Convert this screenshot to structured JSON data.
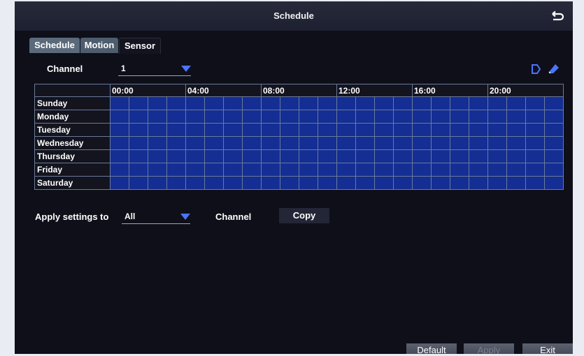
{
  "window": {
    "title": "Schedule"
  },
  "tabs": [
    {
      "label": "Schedule"
    },
    {
      "label": "Motion"
    },
    {
      "label": "Sensor"
    }
  ],
  "channel": {
    "label": "Channel",
    "value": "1"
  },
  "grid": {
    "hour_labels": [
      "00:00",
      "04:00",
      "08:00",
      "12:00",
      "16:00",
      "20:00"
    ],
    "days": [
      "Sunday",
      "Monday",
      "Tuesday",
      "Wednesday",
      "Thursday",
      "Friday",
      "Saturday"
    ],
    "slot_color": "#142e93"
  },
  "apply_settings": {
    "label": "Apply settings to",
    "value": "All",
    "channel_label": "Channel",
    "copy_label": "Copy"
  },
  "footer": {
    "default_label": "Default",
    "apply_label": "Apply",
    "exit_label": "Exit"
  },
  "colors": {
    "accent": "#4b74ff",
    "background": "#0e0f19",
    "titlebar": "#1d2030"
  }
}
